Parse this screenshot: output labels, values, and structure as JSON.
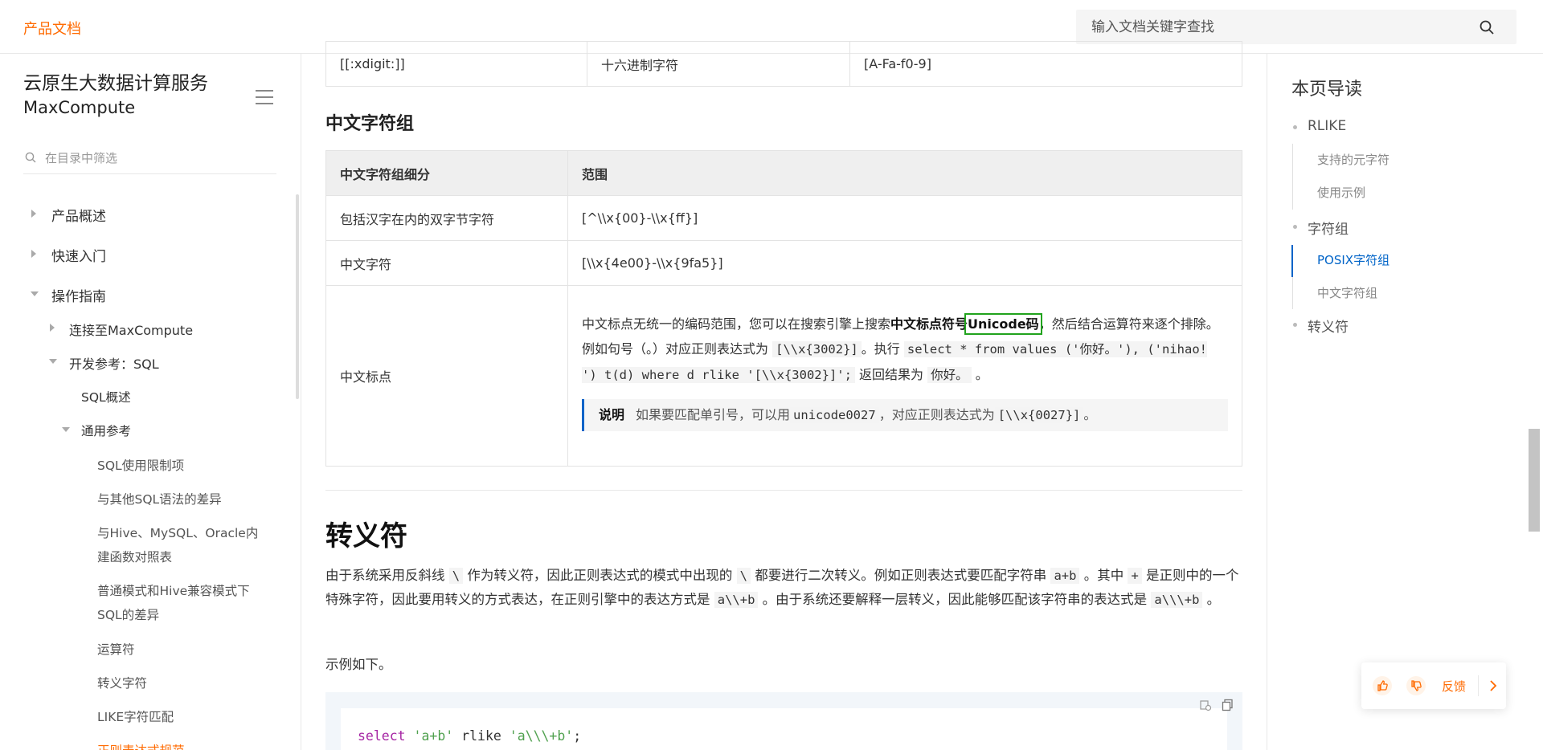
{
  "header": {
    "brand": "产品文档",
    "search_placeholder": "输入文档关键字查找"
  },
  "sidebar": {
    "product_title_line1": "云原生大数据计算服务",
    "product_title_line2": "MaxCompute",
    "filter_placeholder": "在目录中筛选",
    "items": [
      {
        "label": "产品概述"
      },
      {
        "label": "快速入门"
      },
      {
        "label": "操作指南"
      },
      {
        "label": "连接至MaxCompute"
      },
      {
        "label": "开发参考：SQL"
      },
      {
        "label": "SQL概述"
      },
      {
        "label": "通用参考"
      },
      {
        "label": "SQL使用限制项"
      },
      {
        "label": "与其他SQL语法的差异"
      },
      {
        "label": "与Hive、MySQL、Oracle内"
      },
      {
        "label": "建函数对照表"
      },
      {
        "label": "普通模式和Hive兼容模式下"
      },
      {
        "label": "SQL的差异"
      },
      {
        "label": "运算符"
      },
      {
        "label": "转义字符"
      },
      {
        "label": "LIKE字符匹配"
      },
      {
        "label": "正则表达式规范"
      }
    ]
  },
  "main": {
    "top_row": [
      "[[:xdigit:]]",
      "十六进制字符",
      "[A-Fa-f0-9]"
    ],
    "cn_group_title": "中文字符组",
    "cn_table": {
      "headers": [
        "中文字符组细分",
        "范围"
      ],
      "rows": [
        {
          "name": "包括汉字在内的双字节字符",
          "range": "[^\\\\x{00}-\\\\x{ff}]"
        },
        {
          "name": "中文字符",
          "range": "[\\\\x{4e00}-\\\\x{9fa5}]"
        }
      ],
      "punct_name": "中文标点",
      "punct_desc_1": "中文标点无统一的编码范围，您可以在搜索引擎上搜索",
      "punct_desc_bold1": "中文标点符号",
      "punct_desc_bold2": "Unicode码",
      "punct_desc_2": "，然后结合运算符来逐个排除。",
      "punct_eg_1": "例如句号（。）对应正则表达式为",
      "punct_eg_code1": "[\\\\x{3002}]",
      "punct_eg_2": "。执行",
      "punct_eg_code2": "select * from values ('你好。'), ('nihao! ') t(d) where d rlike '[\\\\x{3002}]';",
      "punct_eg_3": "返回结果为",
      "punct_eg_code3": "你好。",
      "punct_eg_4": "。",
      "note_label": "说明",
      "note_1": "如果要匹配单引号，可以用",
      "note_code1": "unicode0027",
      "note_2": "，对应正则表达式为",
      "note_code2": "[\\\\x{0027}]",
      "note_3": "。"
    },
    "escape_title": "转义符",
    "escape_p1": "由于系统采用反斜线",
    "escape_c1": "\\",
    "escape_p2": "作为转义符，因此正则表达式的模式中出现的",
    "escape_c2": "\\",
    "escape_p3": "都要进行二次转义。例如正则表达式要匹配字符串",
    "escape_c3": "a+b",
    "escape_p4": "。其中",
    "escape_c4": "+",
    "escape_p5": "是正则中的一个特殊字符，因此要用转义的方式表达，在正则引擎中的表达方式是",
    "escape_c5": "a\\\\+b",
    "escape_p6": "。由于系统还要解释一层转义，因此能够匹配该字符串的表达式是",
    "escape_c6": "a\\\\\\+b",
    "escape_p7": "。",
    "example_intro": "示例如下。",
    "code_kw": "select",
    "code_s1": "'a+b'",
    "code_mid": " rlike ",
    "code_s2": "'a\\\\\\+b'",
    "code_end": ";"
  },
  "toc": {
    "title": "本页导读",
    "items": [
      {
        "label": "RLIKE"
      },
      {
        "label": "支持的元字符"
      },
      {
        "label": "使用示例"
      },
      {
        "label": "字符组"
      },
      {
        "label": "POSIX字符组"
      },
      {
        "label": "中文字符组"
      },
      {
        "label": "转义符"
      }
    ]
  },
  "feedback": {
    "label": "反馈"
  },
  "colors": {
    "brand": "#ff6a00",
    "link": "#0064c8",
    "highlight_box": "#21a31d"
  }
}
